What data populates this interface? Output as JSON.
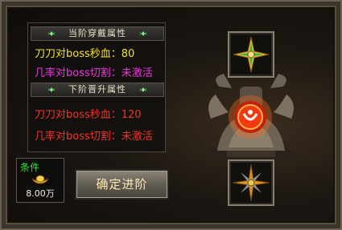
{
  "current": {
    "header": "当阶穿戴属性",
    "attr1": "刀刀对boss秒血：80",
    "attr2": "几率对boss切割：未激活"
  },
  "next": {
    "header": "下阶晋升属性",
    "attr1": "刀刀对boss秒血：120",
    "attr2": "几率对boss切割：未激活"
  },
  "condition": {
    "label": "条件",
    "amount": "8.00万",
    "icon": "gold-ingot-icon"
  },
  "confirm_button": "确定进阶",
  "colors": {
    "yellow": "#f0e12d",
    "magenta": "#e83ad9",
    "red": "#f0342b",
    "green": "#2fe23a"
  }
}
